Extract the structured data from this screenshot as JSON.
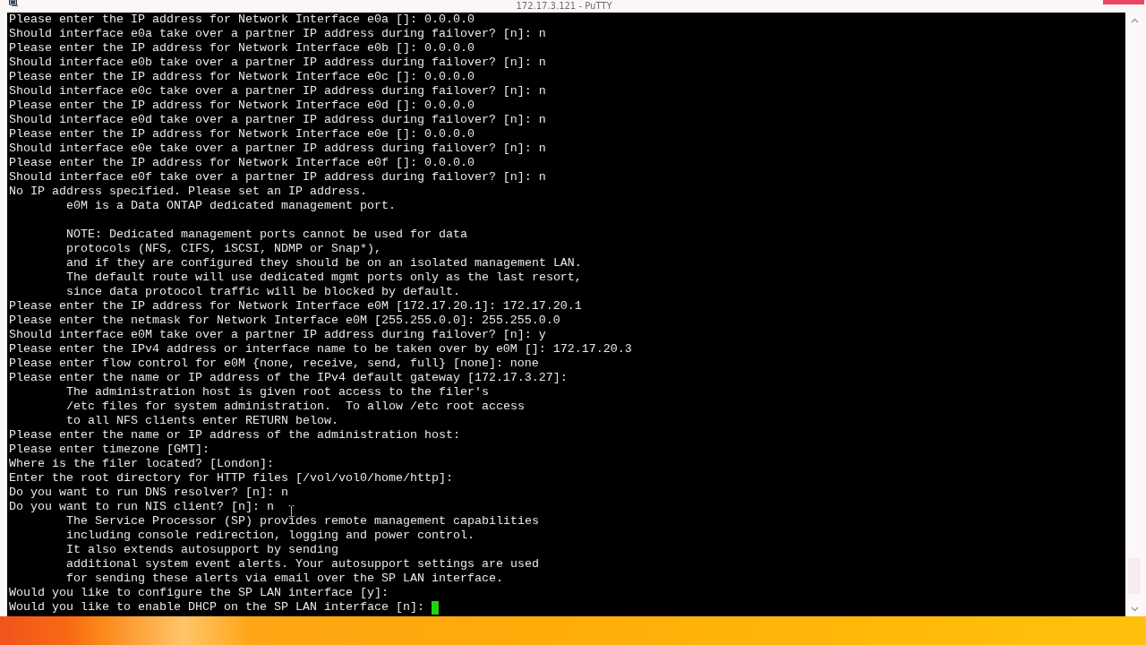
{
  "window": {
    "title": "172.17.3.121 - PuTTY"
  },
  "terminal": {
    "cursor_visible": true,
    "lines": [
      {
        "kind": "text",
        "text": "Please enter the IP address for Network Interface e0a []: 0.0.0.0"
      },
      {
        "kind": "text",
        "text": "Should interface e0a take over a partner IP address during failover? [n]: n"
      },
      {
        "kind": "text",
        "text": "Please enter the IP address for Network Interface e0b []: 0.0.0.0"
      },
      {
        "kind": "text",
        "text": "Should interface e0b take over a partner IP address during failover? [n]: n"
      },
      {
        "kind": "text",
        "text": "Please enter the IP address for Network Interface e0c []: 0.0.0.0"
      },
      {
        "kind": "text",
        "text": "Should interface e0c take over a partner IP address during failover? [n]: n"
      },
      {
        "kind": "text",
        "text": "Please enter the IP address for Network Interface e0d []: 0.0.0.0"
      },
      {
        "kind": "text",
        "text": "Should interface e0d take over a partner IP address during failover? [n]: n"
      },
      {
        "kind": "text",
        "text": "Please enter the IP address for Network Interface e0e []: 0.0.0.0"
      },
      {
        "kind": "text",
        "text": "Should interface e0e take over a partner IP address during failover? [n]: n"
      },
      {
        "kind": "text",
        "text": "Please enter the IP address for Network Interface e0f []: 0.0.0.0"
      },
      {
        "kind": "text",
        "text": "Should interface e0f take over a partner IP address during failover? [n]: n"
      },
      {
        "kind": "text",
        "text": "No IP address specified. Please set an IP address."
      },
      {
        "kind": "indented",
        "text": "e0M is a Data ONTAP dedicated management port."
      },
      {
        "kind": "blank"
      },
      {
        "kind": "indented",
        "text": "NOTE: Dedicated management ports cannot be used for data"
      },
      {
        "kind": "indented",
        "text": "protocols (NFS, CIFS, iSCSI, NDMP or Snap*),"
      },
      {
        "kind": "indented",
        "text": "and if they are configured they should be on an isolated management LAN."
      },
      {
        "kind": "indented",
        "text": "The default route will use dedicated mgmt ports only as the last resort,"
      },
      {
        "kind": "indented",
        "text": "since data protocol traffic will be blocked by default."
      },
      {
        "kind": "text",
        "text": "Please enter the IP address for Network Interface e0M [172.17.20.1]: 172.17.20.1"
      },
      {
        "kind": "text",
        "text": "Please enter the netmask for Network Interface e0M [255.255.0.0]: 255.255.0.0"
      },
      {
        "kind": "text",
        "text": "Should interface e0M take over a partner IP address during failover? [n]: y"
      },
      {
        "kind": "text",
        "text": "Please enter the IPv4 address or interface name to be taken over by e0M []: 172.17.20.3"
      },
      {
        "kind": "text",
        "text": "Please enter flow control for e0M {none, receive, send, full} [none]: none"
      },
      {
        "kind": "text",
        "text": "Please enter the name or IP address of the IPv4 default gateway [172.17.3.27]:"
      },
      {
        "kind": "indented",
        "text": "The administration host is given root access to the filer's"
      },
      {
        "kind": "indented",
        "text": "/etc files for system administration.  To allow /etc root access"
      },
      {
        "kind": "indented",
        "text": "to all NFS clients enter RETURN below."
      },
      {
        "kind": "text",
        "text": "Please enter the name or IP address of the administration host:"
      },
      {
        "kind": "text",
        "text": "Please enter timezone [GMT]:"
      },
      {
        "kind": "text",
        "text": "Where is the filer located? [London]:"
      },
      {
        "kind": "text",
        "text": "Enter the root directory for HTTP files [/vol/vol0/home/http]:"
      },
      {
        "kind": "text",
        "text": "Do you want to run DNS resolver? [n]: n"
      },
      {
        "kind": "text",
        "text": "Do you want to run NIS client? [n]: n"
      },
      {
        "kind": "indented",
        "text": "The Service Processor (SP) provides remote management capabilities"
      },
      {
        "kind": "indented",
        "text": "including console redirection, logging and power control."
      },
      {
        "kind": "indented",
        "text": "It also extends autosupport by sending"
      },
      {
        "kind": "indented",
        "text": "additional system event alerts. Your autosupport settings are used"
      },
      {
        "kind": "indented",
        "text": "for sending these alerts via email over the SP LAN interface."
      },
      {
        "kind": "text",
        "text": "Would you like to configure the SP LAN interface [y]:"
      },
      {
        "kind": "text",
        "text": "Would you like to enable DHCP on the SP LAN interface [n]:"
      }
    ]
  }
}
